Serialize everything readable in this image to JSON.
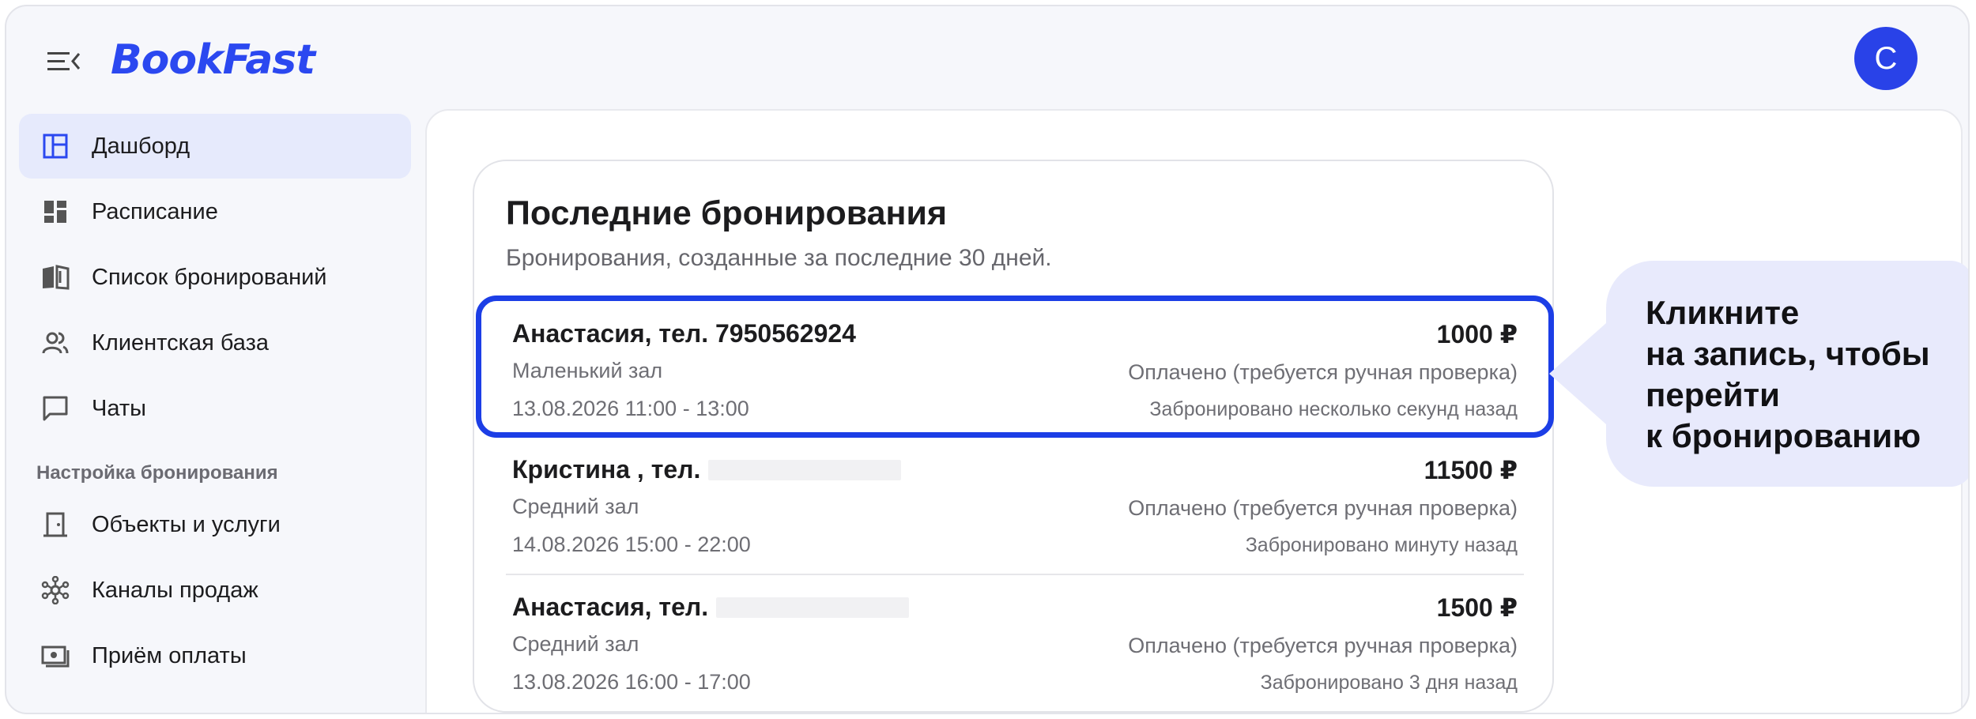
{
  "app": {
    "logo": "BookFast",
    "avatar_letter": "C",
    "accent_color": "#2b48f0"
  },
  "sidebar": {
    "items": [
      {
        "label": "Дашборд",
        "icon": "dashboard-icon",
        "active": true
      },
      {
        "label": "Расписание",
        "icon": "schedule-icon",
        "active": false
      },
      {
        "label": "Список бронирований",
        "icon": "book-icon",
        "active": false
      },
      {
        "label": "Клиентская база",
        "icon": "users-icon",
        "active": false
      },
      {
        "label": "Чаты",
        "icon": "chat-icon",
        "active": false
      }
    ],
    "section_title": "Настройка бронирования",
    "settings_items": [
      {
        "label": "Объекты и услуги",
        "icon": "door-icon"
      },
      {
        "label": "Каналы продаж",
        "icon": "network-icon"
      },
      {
        "label": "Приём оплаты",
        "icon": "payment-icon"
      }
    ]
  },
  "card": {
    "title": "Последние бронирования",
    "subtitle": "Бронирования, созданные за последние 30 дней.",
    "bookings": [
      {
        "name": "Анастасия, тел. 7950562924",
        "hall": "Маленький зал",
        "time": "13.08.2026 11:00 - 13:00",
        "price": "1000 ₽",
        "status": "Оплачено (требуется ручная проверка)",
        "created": "Забронировано несколько секунд назад"
      },
      {
        "name": "Кристина , тел.",
        "hall": "Средний зал",
        "time": "14.08.2026 15:00 - 22:00",
        "price": "11500 ₽",
        "status": "Оплачено (требуется ручная проверка)",
        "created": "Забронировано минуту назад"
      },
      {
        "name": "Анастасия, тел.",
        "hall": "Средний зал",
        "time": "13.08.2026 16:00 - 17:00",
        "price": "1500 ₽",
        "status": "Оплачено (требуется ручная проверка)",
        "created": "Забронировано 3 дня назад"
      }
    ]
  },
  "callout": {
    "text": "Кликните\nна запись, чтобы\nперейти\nк бронированию"
  }
}
